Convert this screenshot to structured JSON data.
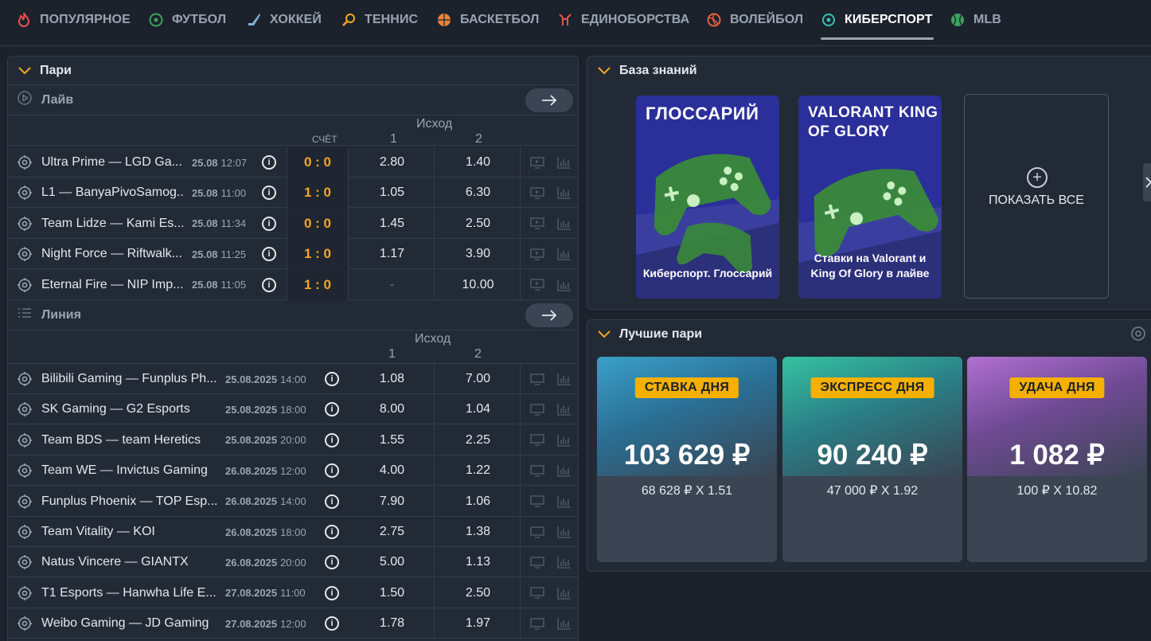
{
  "nav": [
    {
      "label": "ПОПУЛЯРНОЕ",
      "icon": "flame-icon",
      "color": "#e8504a"
    },
    {
      "label": "ФУТБОЛ",
      "icon": "soccer-ball-icon",
      "color": "#3aa35a"
    },
    {
      "label": "ХОККЕЙ",
      "icon": "hockey-stick-icon",
      "color": "#7fb3d5"
    },
    {
      "label": "ТЕННИС",
      "icon": "tennis-racket-icon",
      "color": "#f5a623"
    },
    {
      "label": "БАСКЕТБОЛ",
      "icon": "basketball-icon",
      "color": "#e8843a"
    },
    {
      "label": "ЕДИНОБОРСТВА",
      "icon": "martial-arts-icon",
      "color": "#e8504a"
    },
    {
      "label": "ВОЛЕЙБОЛ",
      "icon": "volleyball-icon",
      "color": "#e8603a"
    },
    {
      "label": "КИБЕРСПОРТ",
      "icon": "esports-icon",
      "color": "#35c2b0",
      "active": true
    },
    {
      "label": "MLB",
      "icon": "baseball-icon",
      "color": "#3aa35a"
    }
  ],
  "bets": {
    "title": "Пари",
    "live": {
      "title": "Лайв",
      "outcome_label": "Исход",
      "score_label": "СЧЁТ",
      "col1": "1",
      "col2": "2",
      "rows": [
        {
          "name": "Ultra Prime — LGD Ga...",
          "date": "25.08",
          "time": "12:07",
          "score": "0 : 0",
          "o1": "2.80",
          "o2": "1.40"
        },
        {
          "name": "L1 — BanyaPivoSamog...",
          "date": "25.08",
          "time": "11:00",
          "score": "1 : 0",
          "o1": "1.05",
          "o2": "6.30"
        },
        {
          "name": "Team Lidze — Kami Es...",
          "date": "25.08",
          "time": "11:34",
          "score": "0 : 0",
          "o1": "1.45",
          "o2": "2.50"
        },
        {
          "name": "Night Force — Riftwalk...",
          "date": "25.08",
          "time": "11:25",
          "score": "1 : 0",
          "o1": "1.17",
          "o2": "3.90"
        },
        {
          "name": "Eternal Fire — NIP Imp...",
          "date": "25.08",
          "time": "11:05",
          "score": "1 : 0",
          "o1": "-",
          "o2": "10.00"
        }
      ]
    },
    "line": {
      "title": "Линия",
      "outcome_label": "Исход",
      "col1": "1",
      "col2": "2",
      "rows": [
        {
          "name": "Bilibili Gaming — Funplus Ph...",
          "date": "25.08.2025",
          "time": "14:00",
          "o1": "1.08",
          "o2": "7.00"
        },
        {
          "name": "SK Gaming — G2 Esports",
          "date": "25.08.2025",
          "time": "18:00",
          "o1": "8.00",
          "o2": "1.04"
        },
        {
          "name": "Team BDS — team Heretics",
          "date": "25.08.2025",
          "time": "20:00",
          "o1": "1.55",
          "o2": "2.25"
        },
        {
          "name": "Team WE — Invictus Gaming",
          "date": "26.08.2025",
          "time": "12:00",
          "o1": "4.00",
          "o2": "1.22"
        },
        {
          "name": "Funplus Phoenix — TOP Esp...",
          "date": "26.08.2025",
          "time": "14:00",
          "o1": "7.90",
          "o2": "1.06"
        },
        {
          "name": "Team Vitality — KOI",
          "date": "26.08.2025",
          "time": "18:00",
          "o1": "2.75",
          "o2": "1.38"
        },
        {
          "name": "Natus Vincere — GIANTX",
          "date": "26.08.2025",
          "time": "20:00",
          "o1": "5.00",
          "o2": "1.13"
        },
        {
          "name": "T1 Esports — Hanwha Life E...",
          "date": "27.08.2025",
          "time": "11:00",
          "o1": "1.50",
          "o2": "2.50"
        },
        {
          "name": "Weibo Gaming — JD Gaming",
          "date": "27.08.2025",
          "time": "12:00",
          "o1": "1.78",
          "o2": "1.97"
        }
      ]
    }
  },
  "knowledge": {
    "title": "База знаний",
    "cards": [
      {
        "top": "ГЛОССАРИЙ",
        "caption": "Киберспорт. Глоссарий"
      },
      {
        "top": "VALORANT KING OF GLORY",
        "caption": "Ставки на Valorant и King Of Glory в лайве"
      }
    ],
    "show_all": "ПОКАЗАТЬ ВСЕ"
  },
  "best": {
    "title": "Лучшие пари",
    "cards": [
      {
        "badge": "СТАВКА ДНЯ",
        "amount": "103 629 ₽",
        "detail": "68 628 ₽ X 1.51",
        "color": "#3aa0c8"
      },
      {
        "badge": "ЭКСПРЕСС ДНЯ",
        "amount": "90 240 ₽",
        "detail": "47 000 ₽ X 1.92",
        "color": "#35c2a0"
      },
      {
        "badge": "УДАЧА ДНЯ",
        "amount": "1 082 ₽",
        "detail": "100 ₽ X 10.82",
        "color": "#a060c8"
      }
    ]
  },
  "colors": {
    "accent": "#f5a623",
    "bg": "#1b222c",
    "panel": "#222a35",
    "badge": "#f5b000"
  }
}
